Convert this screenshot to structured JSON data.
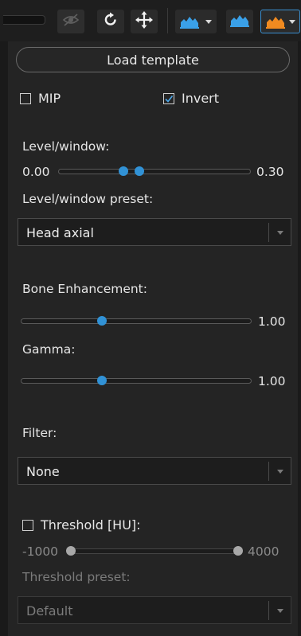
{
  "toolbar": {
    "icons": [
      "slider-slot",
      "eye-off-icon",
      "rotate-icon",
      "pan-move-icon",
      "histogram-dropdown-icon",
      "histogram-icon",
      "histogram-active-dropdown-icon"
    ],
    "accent_blue": "#3aa0e8",
    "accent_orange": "#f08a20"
  },
  "load_template": {
    "label": "Load template"
  },
  "mip": {
    "label": "MIP",
    "checked": false
  },
  "invert": {
    "label": "Invert",
    "checked": true
  },
  "level_window": {
    "label": "Level/window:",
    "min_label": "0.00",
    "max_label": "0.30",
    "low_fraction": 0.34,
    "high_fraction": 0.42
  },
  "level_window_preset": {
    "label": "Level/window preset:",
    "selected": "Head axial"
  },
  "bone_enhancement": {
    "label": "Bone Enhancement:",
    "value": "1.00",
    "fraction": 0.35
  },
  "gamma": {
    "label": "Gamma:",
    "value": "1.00",
    "fraction": 0.35
  },
  "filter": {
    "label": "Filter:",
    "selected": "None"
  },
  "threshold": {
    "label": "Threshold [HU]:",
    "checked": false,
    "min_label": "-1000",
    "max_label": "4000"
  },
  "threshold_preset": {
    "label": "Threshold preset:",
    "selected": "Default"
  },
  "slider_color": "#3192d6"
}
